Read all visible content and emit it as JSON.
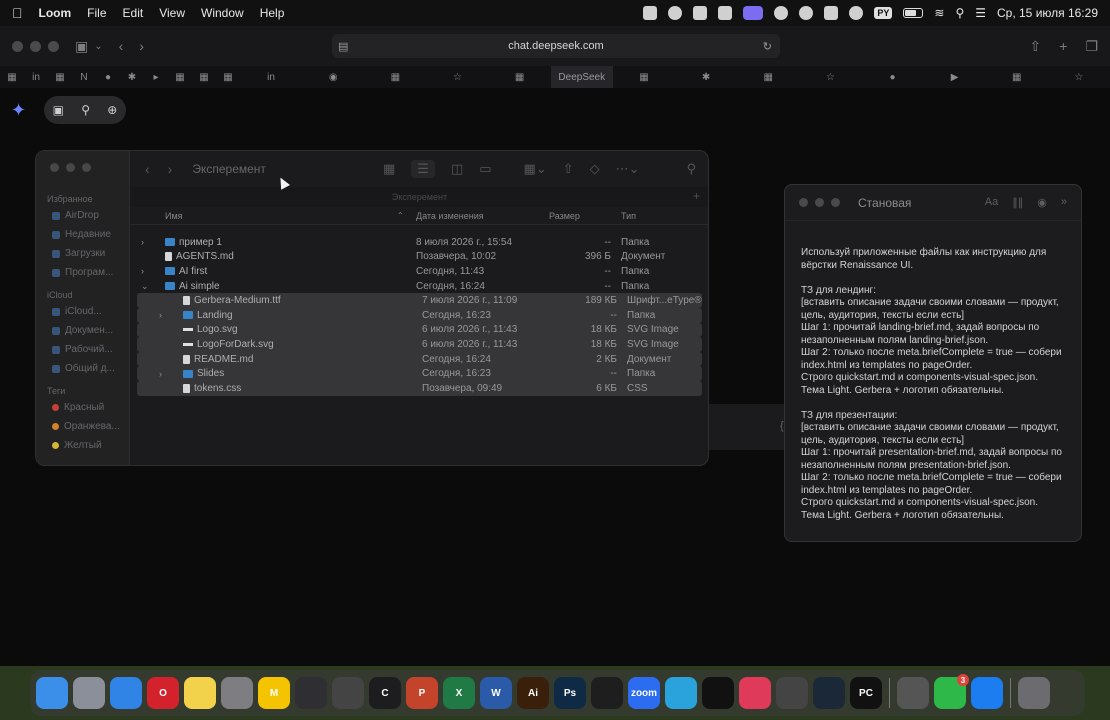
{
  "menubar": {
    "app_name": "Loom",
    "menus": [
      "File",
      "Edit",
      "View",
      "Window",
      "Help"
    ],
    "keyboard_layout": "PY",
    "clock": "Ср, 15 июля  16:29"
  },
  "browser": {
    "url": "chat.deepseek.com",
    "active_tab": "DeepSeek"
  },
  "finder": {
    "window_title": "Эксперемент",
    "path_label": "Эксперемент",
    "sidebar": {
      "favorites_heading": "Избранное",
      "favorites": [
        "AirDrop",
        "Недавние",
        "Загрузки",
        "Програм..."
      ],
      "icloud_heading": "iCloud",
      "icloud": [
        "iCloud...",
        "Докумен...",
        "Рабочий...",
        "Общий д..."
      ],
      "tags_heading": "Теги",
      "tags": [
        {
          "label": "Красный",
          "color": "#d9443c"
        },
        {
          "label": "Оранжева...",
          "color": "#e58a2f"
        },
        {
          "label": "Желтый",
          "color": "#e6c53a"
        }
      ]
    },
    "columns": {
      "name": "Имя",
      "date": "Дата изменения",
      "size": "Размер",
      "type": "Тип"
    },
    "rows": [
      {
        "name": "пример 1",
        "date": "8 июля 2026 г., 15:54",
        "size": "--",
        "type": "Папка",
        "kind": "folder",
        "chevron": "›",
        "indent": false,
        "sel": false
      },
      {
        "name": "AGENTS.md",
        "date": "Позавчера, 10:02",
        "size": "396 Б",
        "type": "Документ",
        "kind": "file",
        "chevron": "",
        "indent": false,
        "sel": false
      },
      {
        "name": "AI first",
        "date": "Сегодня, 11:43",
        "size": "--",
        "type": "Папка",
        "kind": "folder",
        "chevron": "›",
        "indent": false,
        "sel": false
      },
      {
        "name": "Ai simple",
        "date": "Сегодня, 16:24",
        "size": "--",
        "type": "Папка",
        "kind": "folder",
        "chevron": "⌄",
        "indent": false,
        "sel": false
      },
      {
        "name": "Gerbera-Medium.ttf",
        "date": "7 июля 2026 г., 11:09",
        "size": "189 КБ",
        "type": "Шрифт...eType®",
        "kind": "file",
        "chevron": "",
        "indent": true,
        "sel": true
      },
      {
        "name": "Landing",
        "date": "Сегодня, 16:23",
        "size": "--",
        "type": "Папка",
        "kind": "folder",
        "chevron": "›",
        "indent": true,
        "sel": true
      },
      {
        "name": "Logo.svg",
        "date": "6 июля 2026 г., 11:43",
        "size": "18 КБ",
        "type": "SVG Image",
        "kind": "img",
        "chevron": "",
        "indent": true,
        "sel": true
      },
      {
        "name": "LogoForDark.svg",
        "date": "6 июля 2026 г., 11:43",
        "size": "18 КБ",
        "type": "SVG Image",
        "kind": "img",
        "chevron": "",
        "indent": true,
        "sel": true
      },
      {
        "name": "README.md",
        "date": "Сегодня, 16:24",
        "size": "2 КБ",
        "type": "Документ",
        "kind": "file",
        "chevron": "",
        "indent": true,
        "sel": true
      },
      {
        "name": "Slides",
        "date": "Сегодня, 16:23",
        "size": "--",
        "type": "Папка",
        "kind": "folder",
        "chevron": "›",
        "indent": true,
        "sel": true
      },
      {
        "name": "tokens.css",
        "date": "Позавчера, 09:49",
        "size": "6 КБ",
        "type": "CSS",
        "kind": "file",
        "chevron": "",
        "indent": true,
        "sel": true
      }
    ]
  },
  "notes": {
    "title": "Становая",
    "body": "Используй приложенные файлы как инструкцию для вёрстки Renaissance UI.\n\nТЗ для лендинг:\n[вставить описание задачи своими словами — продукт, цель, аудитория, тексты если есть]\nШаг 1: прочитай landing-brief.md, задай вопросы по незаполненным полям landing-brief.json.\nШаг 2: только после meta.briefComplete = true — собери index.html из templates по pageOrder.\nСтрого quickstart.md и components-visual-spec.json.\nТема Light. Gerbera + логотип обязательны.\n\nТЗ для презентации:\n[вставить описание задачи своими словами — продукт, цель, аудитория, тексты если есть]\nШаг 1: прочитай presentation-brief.md, задай вопросы по незаполненным полям presentation-brief.json.\nШаг 2: только после meta.briefComplete = true — собери index.html из templates по pageOrder.\nСтрого quickstart.md и components-visual-spec.json.\nТема Light. Gerbera + логотип обязательны."
  },
  "dock": {
    "apps": [
      {
        "name": "finder",
        "label": "",
        "color": "#3b8fe8"
      },
      {
        "name": "launchpad",
        "label": "",
        "color": "#8a8f99"
      },
      {
        "name": "safari",
        "label": "",
        "color": "#2f84e6"
      },
      {
        "name": "opera",
        "label": "O",
        "color": "#d3222b"
      },
      {
        "name": "notes",
        "label": "",
        "color": "#f3d24b"
      },
      {
        "name": "settings",
        "label": "",
        "color": "#7d7d82"
      },
      {
        "name": "miro",
        "label": "M",
        "color": "#f4c400"
      },
      {
        "name": "loom",
        "label": "",
        "color": "#2f2f33"
      },
      {
        "name": "final-cut",
        "label": "",
        "color": "#444"
      },
      {
        "name": "cursor",
        "label": "C",
        "color": "#1d1d1f"
      },
      {
        "name": "powerpoint",
        "label": "P",
        "color": "#c4432b"
      },
      {
        "name": "excel",
        "label": "X",
        "color": "#1f7a45"
      },
      {
        "name": "word",
        "label": "W",
        "color": "#2a5aa8"
      },
      {
        "name": "illustrator",
        "label": "Ai",
        "color": "#3a1f0a"
      },
      {
        "name": "photoshop",
        "label": "Ps",
        "color": "#0f2a44"
      },
      {
        "name": "figma",
        "label": "",
        "color": "#1e1e1e"
      },
      {
        "name": "zoom",
        "label": "zoom",
        "color": "#2b6cf0"
      },
      {
        "name": "telegram",
        "label": "",
        "color": "#2aa2dc"
      },
      {
        "name": "spark",
        "label": "",
        "color": "#111"
      },
      {
        "name": "git",
        "label": "",
        "color": "#e03a5a"
      },
      {
        "name": "vpn",
        "label": "",
        "color": "#444"
      },
      {
        "name": "steam",
        "label": "",
        "color": "#1b2838"
      },
      {
        "name": "pycharm",
        "label": "PC",
        "color": "#111"
      }
    ],
    "right_apps": [
      {
        "name": "parallels",
        "label": "",
        "color": "#555"
      },
      {
        "name": "facetime",
        "label": "",
        "color": "#2fb84a",
        "badge": "3"
      },
      {
        "name": "app-store",
        "label": "",
        "color": "#1c7df0"
      }
    ]
  }
}
